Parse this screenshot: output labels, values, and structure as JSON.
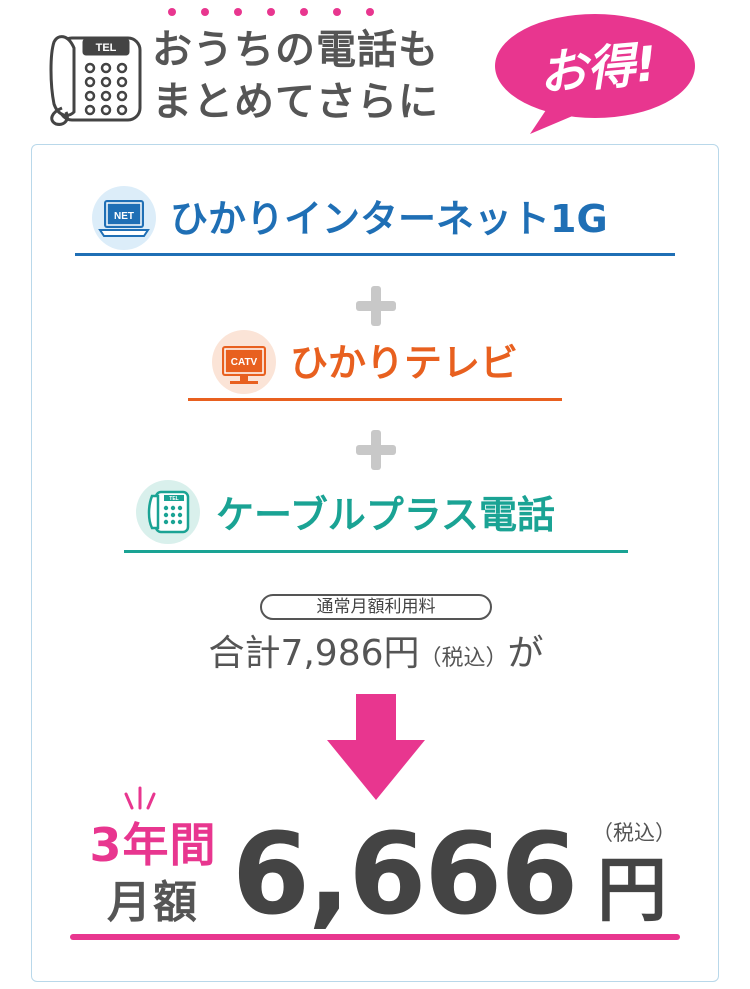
{
  "header": {
    "line1": "おうちの電話も",
    "line2": "まとめてさらに",
    "badge": "お得!",
    "phone_icon": "telephone-icon",
    "phone_label": "TEL",
    "emphasis_dots": 7
  },
  "services": [
    {
      "label": "ひかりインターネット1G",
      "icon": "laptop-icon",
      "icon_text": "NET",
      "color": "#1f6fb5"
    },
    {
      "label": "ひかりテレビ",
      "icon": "tv-icon",
      "icon_text": "CATV",
      "color": "#e8601f"
    },
    {
      "label": "ケーブルプラス電話",
      "icon": "telephone-icon",
      "icon_text": "TEL",
      "color": "#1aa394"
    }
  ],
  "colors": {
    "accent": "#e8368f",
    "text_gray": "#555555",
    "plus_gray": "#c8c8c8",
    "card_border": "#b9d8ea"
  },
  "pricing": {
    "regular_label": "通常月額利用料",
    "total_prefix": "合計",
    "total_amount": "7,986円",
    "tax_note": "（税込）",
    "suffix": "が",
    "period": "3年間",
    "monthly": "月額",
    "price": "6,666",
    "yen": "円",
    "tax_note_2": "（税込）"
  }
}
